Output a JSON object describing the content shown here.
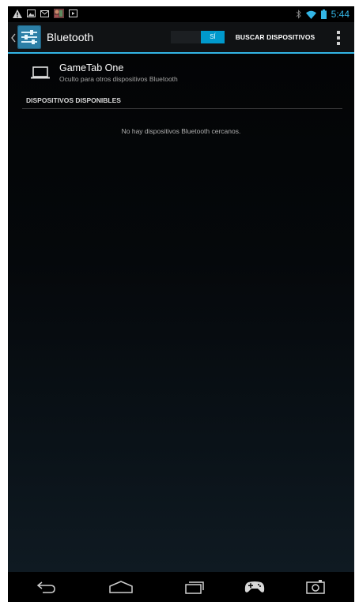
{
  "status_bar": {
    "time": "5:44",
    "left_icons": [
      "warning-icon",
      "image-icon",
      "mail-icon",
      "game-notification-icon",
      "video-icon"
    ],
    "right_icons": [
      "bluetooth-icon",
      "wifi-icon",
      "battery-icon"
    ]
  },
  "action_bar": {
    "title": "Bluetooth",
    "toggle_label": "SÍ",
    "scan_label": "BUSCAR DISPOSITIVOS",
    "accent_color": "#33b5e5"
  },
  "device": {
    "name": "GameTab One",
    "status": "Oculto para otros dispositivos Bluetooth"
  },
  "available": {
    "header": "DISPOSITIVOS DISPONIBLES",
    "empty_message": "No hay dispositivos Bluetooth cercanos."
  },
  "nav_bar": {
    "buttons": [
      "back-icon",
      "home-icon",
      "recents-icon",
      "gamepad-icon",
      "screenshot-icon"
    ]
  }
}
